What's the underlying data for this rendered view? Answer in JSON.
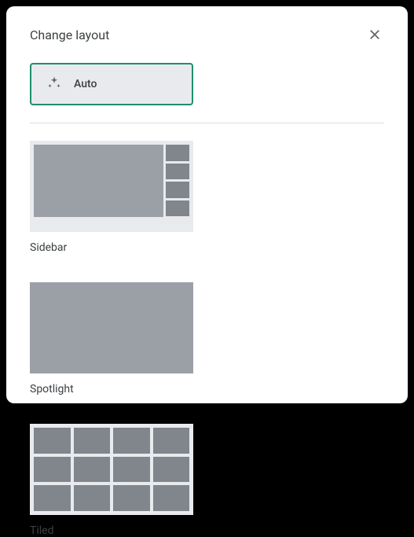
{
  "dialog": {
    "title": "Change layout"
  },
  "auto": {
    "label": "Auto"
  },
  "options": {
    "sidebar": "Sidebar",
    "spotlight": "Spotlight",
    "tiled": "Tiled"
  }
}
